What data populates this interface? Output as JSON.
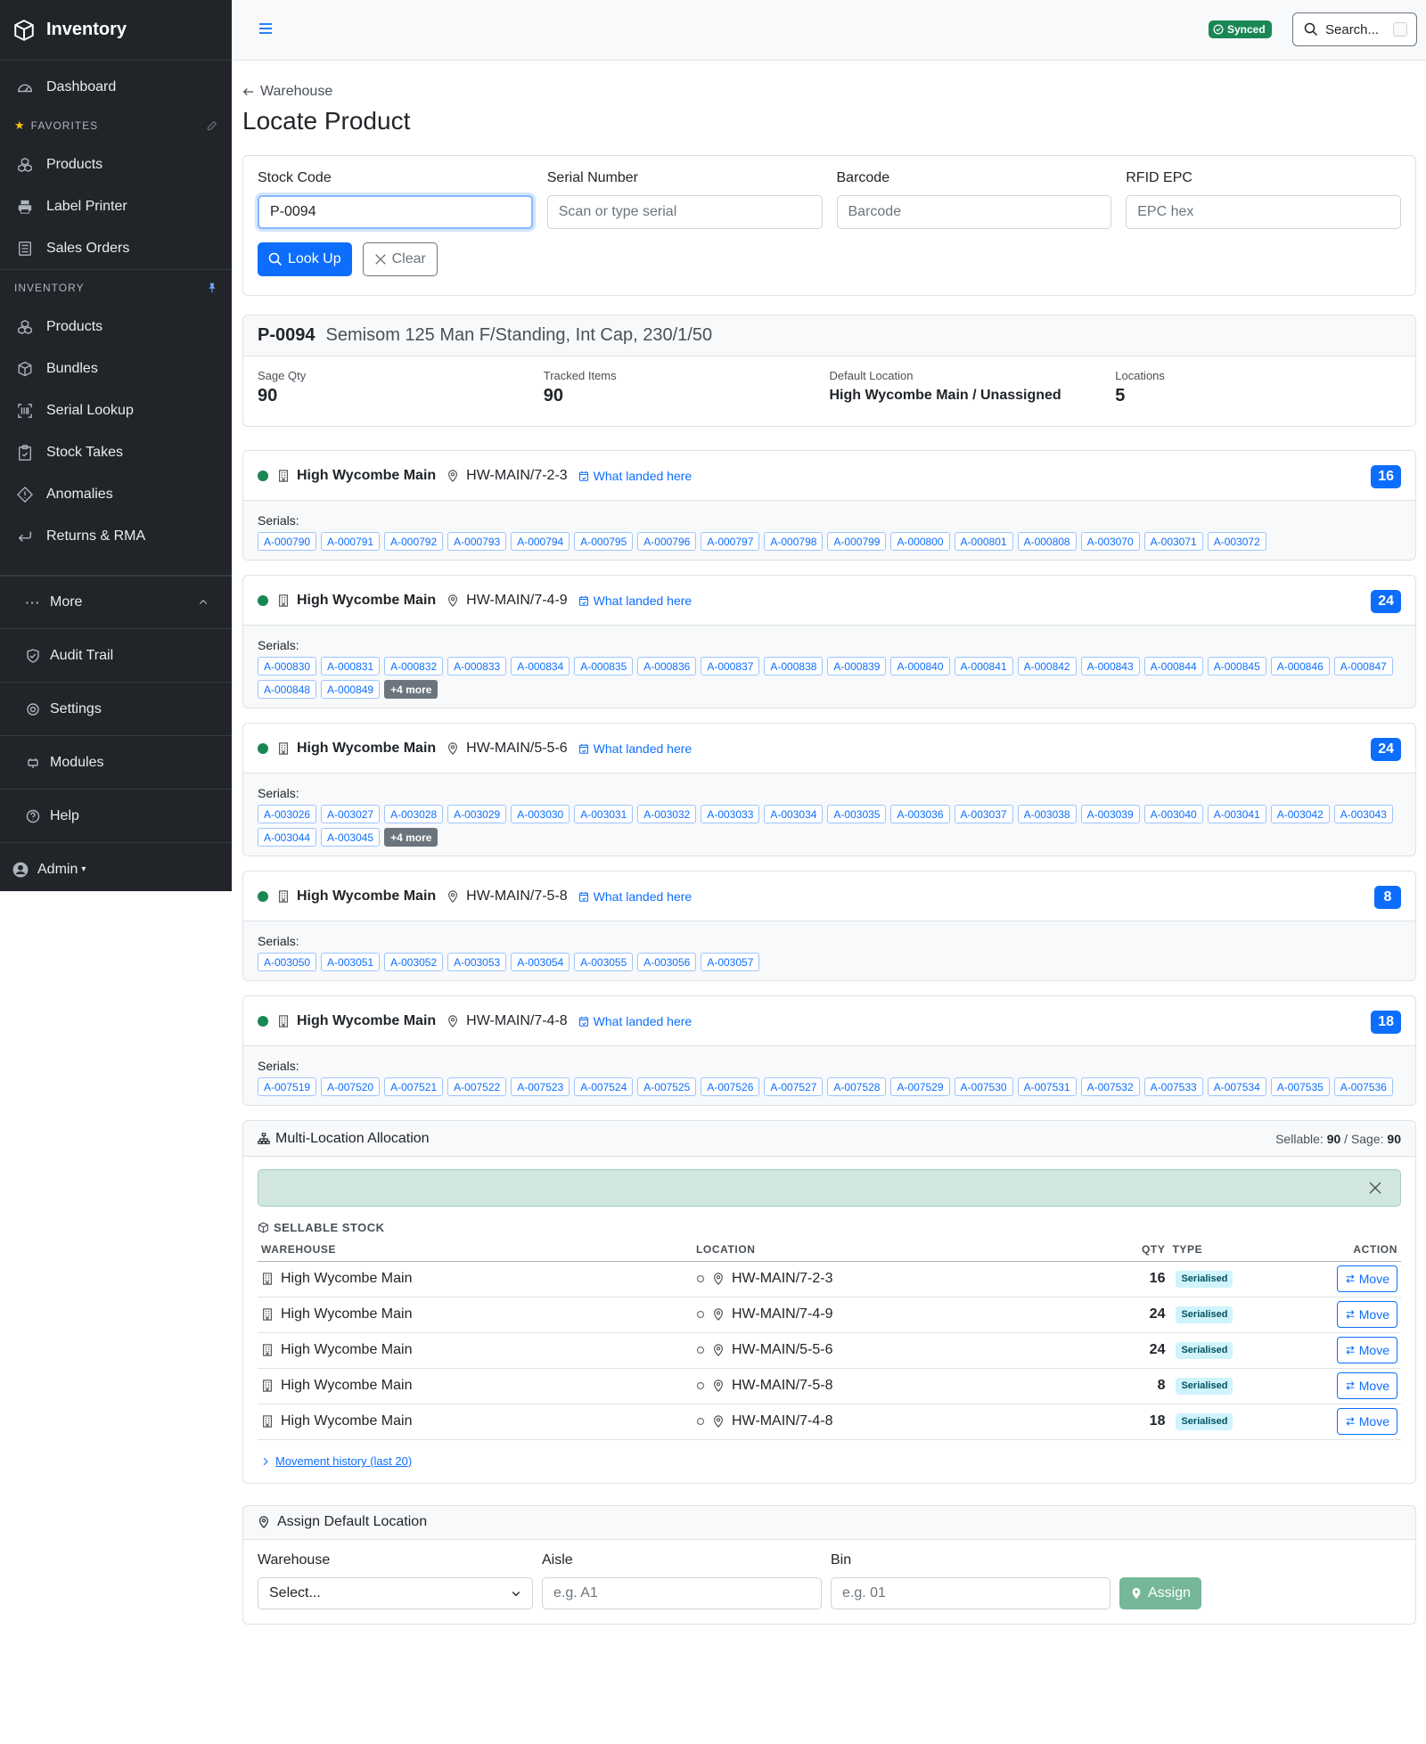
{
  "app": {
    "title": "Inventory"
  },
  "sidebar": {
    "dashboard": "Dashboard",
    "favorites_header": "FAVORITES",
    "favorites": [
      "Products",
      "Label Printer",
      "Sales Orders"
    ],
    "inventory_header": "INVENTORY",
    "inventory": [
      "Products",
      "Bundles",
      "Serial Lookup",
      "Stock Takes",
      "Anomalies",
      "Returns & RMA"
    ],
    "more": "More",
    "audit": "Audit Trail",
    "settings": "Settings",
    "modules": "Modules",
    "help": "Help",
    "user": "Admin"
  },
  "topbar": {
    "status": "Synced",
    "search_label": "Search..."
  },
  "breadcrumb": "Warehouse",
  "page_title": "Locate Product",
  "lookup": {
    "stock_code_label": "Stock Code",
    "stock_code_value": "P-0094",
    "serial_label": "Serial Number",
    "serial_placeholder": "Scan or type serial",
    "barcode_label": "Barcode",
    "barcode_placeholder": "Barcode",
    "rfid_label": "RFID EPC",
    "rfid_placeholder": "EPC hex",
    "lookup_button": "Look Up",
    "clear_button": "Clear"
  },
  "product": {
    "code": "P-0094",
    "description": "Semisom 125 Man F/Standing, Int Cap, 230/1/50",
    "sage_qty_label": "Sage Qty",
    "sage_qty": "90",
    "tracked_label": "Tracked Items",
    "tracked": "90",
    "default_loc_label": "Default Location",
    "default_loc": "High Wycombe Main / Unassigned",
    "locations_label": "Locations",
    "locations": "5"
  },
  "location_cards": [
    {
      "warehouse": "High Wycombe Main",
      "path": "HW-MAIN/7-2-3",
      "landed": "What landed here",
      "count": "16",
      "serials_label": "Serials:",
      "serials": [
        "A-000790",
        "A-000791",
        "A-000792",
        "A-000793",
        "A-000794",
        "A-000795",
        "A-000796",
        "A-000797",
        "A-000798",
        "A-000799",
        "A-000800",
        "A-000801",
        "A-000808",
        "A-003070",
        "A-003071",
        "A-003072"
      ],
      "more": ""
    },
    {
      "warehouse": "High Wycombe Main",
      "path": "HW-MAIN/7-4-9",
      "landed": "What landed here",
      "count": "24",
      "serials_label": "Serials:",
      "serials": [
        "A-000830",
        "A-000831",
        "A-000832",
        "A-000833",
        "A-000834",
        "A-000835",
        "A-000836",
        "A-000837",
        "A-000838",
        "A-000839",
        "A-000840",
        "A-000841",
        "A-000842",
        "A-000843",
        "A-000844",
        "A-000845",
        "A-000846",
        "A-000847",
        "A-000848",
        "A-000849"
      ],
      "more": "+4 more"
    },
    {
      "warehouse": "High Wycombe Main",
      "path": "HW-MAIN/5-5-6",
      "landed": "What landed here",
      "count": "24",
      "serials_label": "Serials:",
      "serials": [
        "A-003026",
        "A-003027",
        "A-003028",
        "A-003029",
        "A-003030",
        "A-003031",
        "A-003032",
        "A-003033",
        "A-003034",
        "A-003035",
        "A-003036",
        "A-003037",
        "A-003038",
        "A-003039",
        "A-003040",
        "A-003041",
        "A-003042",
        "A-003043",
        "A-003044",
        "A-003045"
      ],
      "more": "+4 more"
    },
    {
      "warehouse": "High Wycombe Main",
      "path": "HW-MAIN/7-5-8",
      "landed": "What landed here",
      "count": "8",
      "serials_label": "Serials:",
      "serials": [
        "A-003050",
        "A-003051",
        "A-003052",
        "A-003053",
        "A-003054",
        "A-003055",
        "A-003056",
        "A-003057"
      ],
      "more": ""
    },
    {
      "warehouse": "High Wycombe Main",
      "path": "HW-MAIN/7-4-8",
      "landed": "What landed here",
      "count": "18",
      "serials_label": "Serials:",
      "serials": [
        "A-007519",
        "A-007520",
        "A-007521",
        "A-007522",
        "A-007523",
        "A-007524",
        "A-007525",
        "A-007526",
        "A-007527",
        "A-007528",
        "A-007529",
        "A-007530",
        "A-007531",
        "A-007532",
        "A-007533",
        "A-007534",
        "A-007535",
        "A-007536"
      ],
      "more": ""
    }
  ],
  "allocation": {
    "title": "Multi-Location Allocation",
    "sellable_label": "Sellable:",
    "sellable": "90",
    "sage_label": "Sage:",
    "sage": "90",
    "section": "SELLABLE STOCK",
    "columns": [
      "WAREHOUSE",
      "LOCATION",
      "QTY",
      "TYPE",
      "ACTION"
    ],
    "rows": [
      {
        "warehouse": "High Wycombe Main",
        "location": "HW-MAIN/7-2-3",
        "qty": "16",
        "type": "Serialised",
        "action": "Move"
      },
      {
        "warehouse": "High Wycombe Main",
        "location": "HW-MAIN/7-4-9",
        "qty": "24",
        "type": "Serialised",
        "action": "Move"
      },
      {
        "warehouse": "High Wycombe Main",
        "location": "HW-MAIN/5-5-6",
        "qty": "24",
        "type": "Serialised",
        "action": "Move"
      },
      {
        "warehouse": "High Wycombe Main",
        "location": "HW-MAIN/7-5-8",
        "qty": "8",
        "type": "Serialised",
        "action": "Move"
      },
      {
        "warehouse": "High Wycombe Main",
        "location": "HW-MAIN/7-4-8",
        "qty": "18",
        "type": "Serialised",
        "action": "Move"
      }
    ],
    "movement_link": "Movement history (last 20)"
  },
  "assign": {
    "title": "Assign Default Location",
    "warehouse_label": "Warehouse",
    "warehouse_value": "Select...",
    "aisle_label": "Aisle",
    "aisle_placeholder": "e.g. A1",
    "bin_label": "Bin",
    "bin_placeholder": "e.g. 01",
    "button": "Assign"
  },
  "colors": {
    "primary": "#0d6efd",
    "success": "#198754",
    "sidebar": "#212529"
  }
}
